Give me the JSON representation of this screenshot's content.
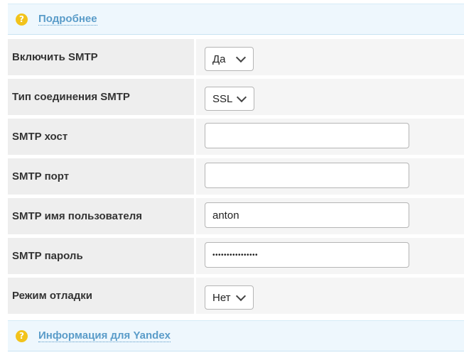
{
  "headers": {
    "details": {
      "label": "Подробнее",
      "icon": "question-icon"
    },
    "yandex": {
      "label": "Информация для Yandex",
      "icon": "question-icon"
    }
  },
  "fields": {
    "smtp_enable": {
      "label": "Включить SMTP",
      "value": "Да"
    },
    "smtp_connection_type": {
      "label": "Тип соединения SMTP",
      "value": "SSL"
    },
    "smtp_host": {
      "label": "SMTP хост",
      "value": ""
    },
    "smtp_port": {
      "label": "SMTP порт",
      "value": ""
    },
    "smtp_username": {
      "label": "SMTP имя пользователя",
      "value": "anton"
    },
    "smtp_password": {
      "label": "SMTP пароль",
      "value": "••••••••••••••••"
    },
    "debug_mode": {
      "label": "Режим отладки",
      "value": "Нет"
    }
  },
  "colors": {
    "header_bg": "#eef7fd",
    "link": "#5a9cc9",
    "help_icon": "#f2c31b",
    "label_bg": "#eeeeee"
  }
}
